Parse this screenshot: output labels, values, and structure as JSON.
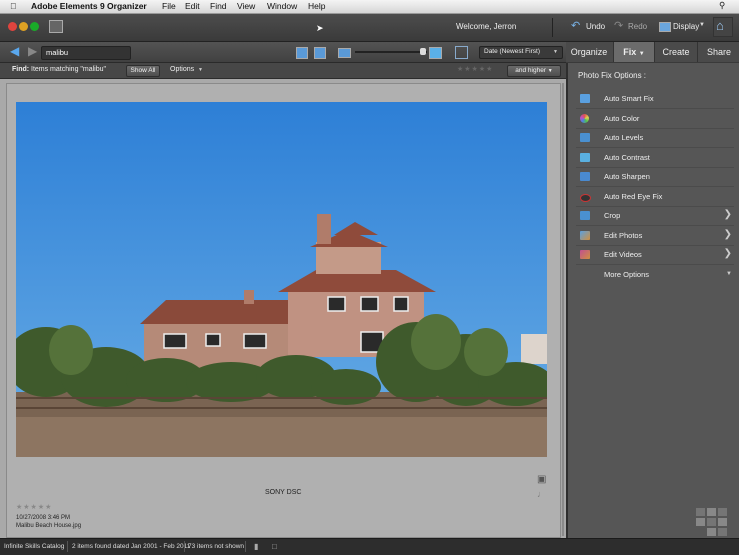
{
  "menubar": {
    "app_name": "Adobe Elements 9 Organizer",
    "items": [
      "File",
      "Edit",
      "Find",
      "View",
      "Window",
      "Help"
    ]
  },
  "titlebar": {
    "welcome": "Welcome, Jerron",
    "undo": "Undo",
    "redo": "Redo",
    "display": "Display"
  },
  "nav": {
    "search_value": "malibu",
    "sort_value": "Date (Newest First)"
  },
  "findbar": {
    "label": "Find:",
    "text": "Items matching \"malibu\"",
    "show_all": "Show All",
    "options": "Options",
    "rating_filter": "and higher"
  },
  "photo": {
    "caption": "SONY DSC",
    "date": "10/27/2008 3:46 PM",
    "filename": "Malibu Beach House.jpg",
    "rating_stars": 0
  },
  "panel": {
    "tabs": [
      "Organize",
      "Fix",
      "Create",
      "Share"
    ],
    "active_tab": "Fix",
    "heading": "Photo Fix Options :",
    "options": [
      {
        "label": "Auto Smart Fix",
        "icon": "smart-fix-icon",
        "color": "#5aa0e0"
      },
      {
        "label": "Auto Color",
        "icon": "color-wheel-icon",
        "color": "#e05050"
      },
      {
        "label": "Auto Levels",
        "icon": "levels-icon",
        "color": "#4a90d0"
      },
      {
        "label": "Auto Contrast",
        "icon": "contrast-icon",
        "color": "#5ab0e0"
      },
      {
        "label": "Auto Sharpen",
        "icon": "sharpen-icon",
        "color": "#4a8ad0"
      },
      {
        "label": "Auto Red Eye Fix",
        "icon": "red-eye-icon",
        "color": "#333333"
      },
      {
        "label": "Crop",
        "icon": "crop-icon",
        "color": "#4a90d0"
      },
      {
        "label": "Edit Photos",
        "icon": "edit-photos-icon",
        "color": "#d09040"
      },
      {
        "label": "Edit Videos",
        "icon": "edit-videos-icon",
        "color": "#c05090"
      },
      {
        "label": "More Options",
        "icon": "",
        "color": ""
      }
    ]
  },
  "status": {
    "catalog": "Infinite Skills Catalog",
    "found": "2 items found dated Jan 2001 - Feb 2011",
    "not_shown": "73 items not shown"
  }
}
